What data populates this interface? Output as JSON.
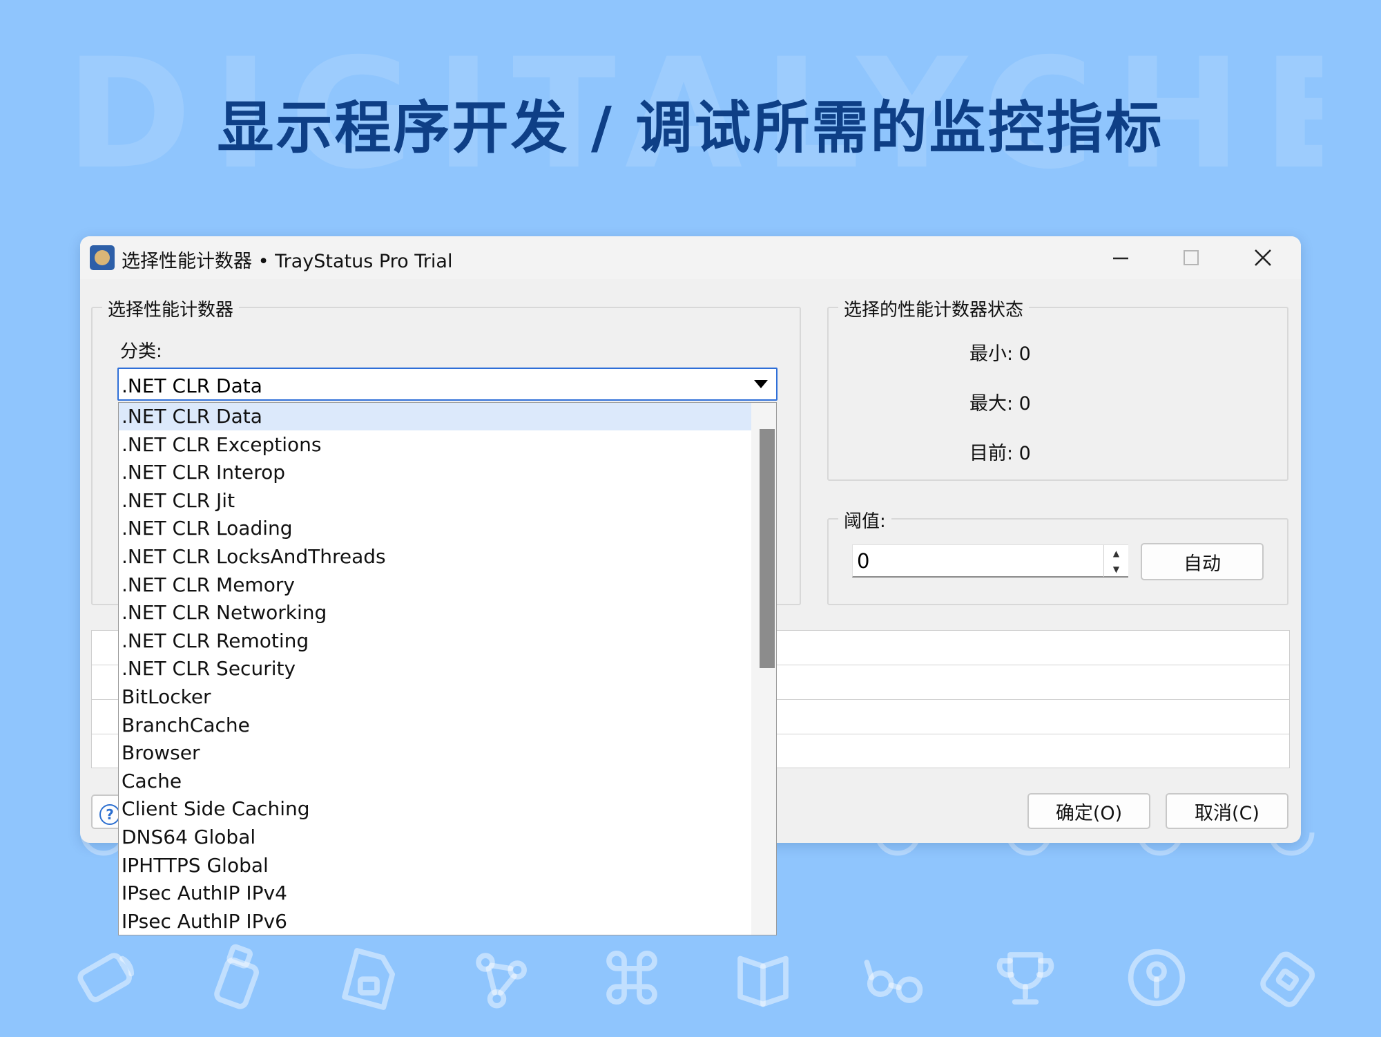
{
  "watermark": "DIGITALYCHEE",
  "headline": "显示程序开发 / 调试所需的监控指标",
  "window": {
    "title": "选择性能计数器 • TrayStatus Pro Trial",
    "minimize_label": "—",
    "close_label": "✕"
  },
  "counter_group": {
    "label": "选择性能计数器",
    "category_label": "分类:",
    "category_value": ".NET CLR Data"
  },
  "status_group": {
    "label": "选择的性能计数器状态",
    "min": "最小: 0",
    "max": "最大: 0",
    "current": "目前: 0"
  },
  "threshold_group": {
    "label": "阈值:",
    "value": "0",
    "auto_button": "自动"
  },
  "footer": {
    "help_glyph": "?",
    "ok_button": "确定(O)",
    "cancel_button": "取消(C)"
  },
  "dropdown": {
    "items": [
      ".NET CLR Data",
      ".NET CLR Exceptions",
      ".NET CLR Interop",
      ".NET CLR Jit",
      ".NET CLR Loading",
      ".NET CLR LocksAndThreads",
      ".NET CLR Memory",
      ".NET CLR Networking",
      ".NET CLR Remoting",
      ".NET CLR Security",
      "BitLocker",
      "BranchCache",
      "Browser",
      "Cache",
      "Client Side Caching",
      "DNS64 Global",
      "IPHTTPS Global",
      "IPsec AuthIP IPv4",
      "IPsec AuthIP IPv6"
    ],
    "selected_index": 0
  },
  "colors": {
    "background": "#8fc5fd",
    "headline": "#0e3f86",
    "selection": "#dce9fb",
    "focus_border": "#2f6fd8"
  },
  "decor_icons": [
    "keyboard-icon",
    "usb-drive-icon",
    "document-lock-icon",
    "network-nodes-icon",
    "command-key-icon",
    "book-icon",
    "glasses-icon",
    "trophy-icon",
    "key-icon",
    "tag-icon"
  ]
}
